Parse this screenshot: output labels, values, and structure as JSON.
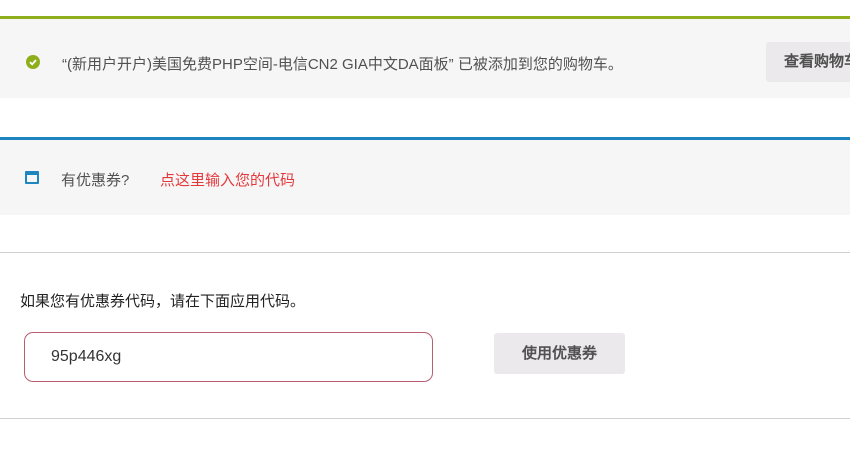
{
  "notice": {
    "message": "“(新用户开户)美国免费PHP空间-电信CN2 GIA中文DA面板” 已被添加到您的购物车。",
    "view_cart_label": "查看购物车",
    "accent": "#8fae1b"
  },
  "coupon_toggle": {
    "question": "有优惠券?",
    "link_text": "点这里输入您的代码",
    "accent": "#1e85be"
  },
  "coupon_form": {
    "description": "如果您有优惠券代码，请在下面应用代码。",
    "code_value": "95p446xg",
    "apply_label": "使用优惠券"
  }
}
